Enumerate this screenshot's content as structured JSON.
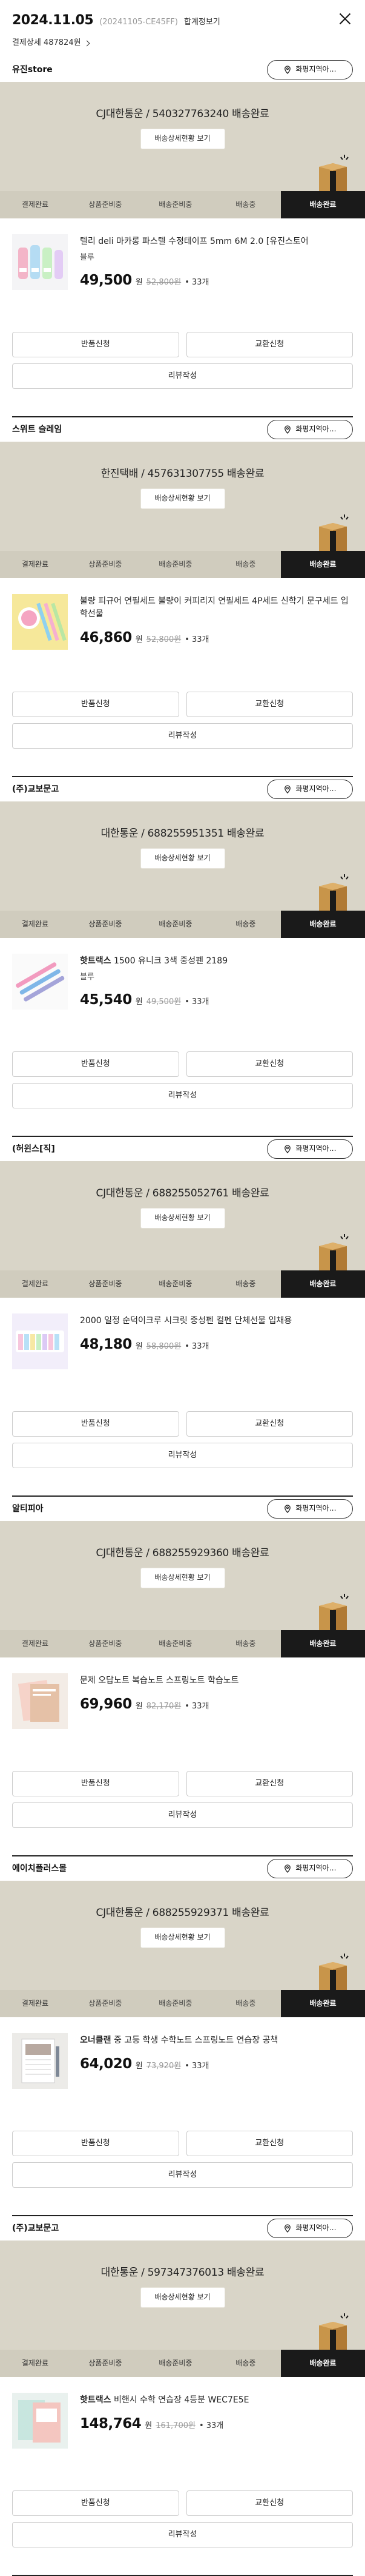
{
  "header": {
    "date": "2024.11.05",
    "order_no": "(20241105-CE45FF)",
    "merge_label": "합계정보기",
    "pay_detail": "결제상세 487824원"
  },
  "steps": [
    "결제완료",
    "상품준비중",
    "배송준비중",
    "배송중",
    "배송완료"
  ],
  "actions": {
    "return": "반품신청",
    "exchange": "교환신청",
    "review": "리뷰작성"
  },
  "map_button": "화평지역아…",
  "track_button": "배송상세현황 보기",
  "orders": [
    {
      "seller": "유진store",
      "shipping": "CJ대한통운 / 540327763240 배송완료",
      "name_bold": "",
      "name": "텔리 deli 마카롱 파스텔 수정테이프 5mm 6M 2.0 [유진스토어",
      "option": "블루",
      "price": "49,500",
      "orig": "52,800원",
      "qty": "33개",
      "thumb": "a"
    },
    {
      "seller": "스위트 슬레임",
      "shipping": "한진택배 / 457631307755 배송완료",
      "name_bold": "",
      "name": "불량 피규어 연필세트 불량이 커피리지 연필세트 4P세트 신학기 문구세트 입학선물",
      "option": "",
      "price": "46,860",
      "orig": "52,800원",
      "qty": "33개",
      "thumb": "b"
    },
    {
      "seller": "(주)교보문고",
      "shipping": "대한통운 / 688255951351 배송완료",
      "name_bold": "핫트랙스",
      "name": " 1500 유니크 3색 중성펜 2189",
      "option": "블루",
      "price": "45,540",
      "orig": "49,500원",
      "qty": "33개",
      "thumb": "c"
    },
    {
      "seller": "(허윈스[직]",
      "shipping": "CJ대한통운 / 688255052761 배송완료",
      "name_bold": "",
      "name": "2000 일정 순덕이크루 시크릿 중성펜 컬펜 단체선물 입채용",
      "option": "",
      "price": "48,180",
      "orig": "58,800원",
      "qty": "33개",
      "thumb": "d"
    },
    {
      "seller": "알티피아",
      "shipping": "CJ대한통운 / 688255929360 배송완료",
      "name_bold": "",
      "name": "문제 오답노트 복습노트 스프링노트 학습노트",
      "option": "",
      "price": "69,960",
      "orig": "82,170원",
      "qty": "33개",
      "thumb": "e"
    },
    {
      "seller": "에이치플러스몰",
      "shipping": "CJ대한통운 / 688255929371 배송완료",
      "name_bold": "오너클랜",
      "name": " 중 고등 학생 수학노트 스프링노트 연습장 공책",
      "option": "",
      "price": "64,020",
      "orig": "73,920원",
      "qty": "33개",
      "thumb": "f"
    },
    {
      "seller": "(주)교보문고",
      "shipping": "대한통운 / 597347376013 배송완료",
      "name_bold": "핫트랙스",
      "name": " 비핸시 수학 연습장 4등분 WEC7E5E",
      "option": "",
      "price": "148,764",
      "orig": "161,700원",
      "qty": "33개",
      "thumb": "g"
    }
  ]
}
